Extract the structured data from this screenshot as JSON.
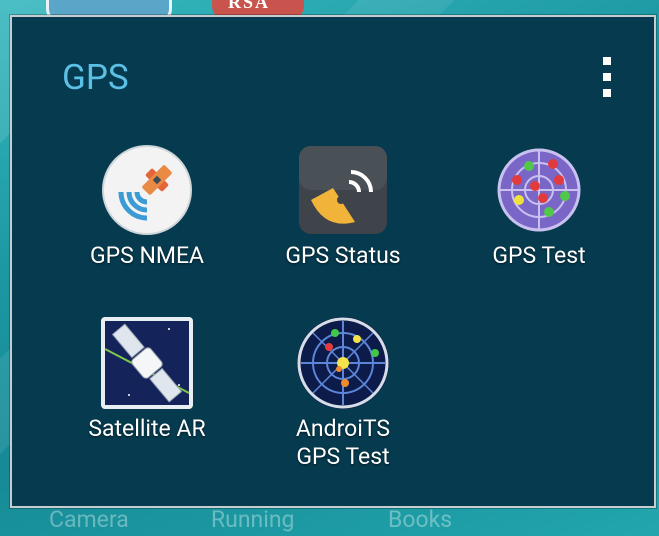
{
  "background": {
    "dock_labels": [
      "Camera",
      "Running",
      "Books"
    ],
    "top_icon_text": "RSA"
  },
  "folder": {
    "title": "GPS",
    "menu_icon": "overflow-menu-icon",
    "apps": [
      {
        "label": "GPS NMEA",
        "icon": "satellite-signal-icon"
      },
      {
        "label": "GPS Status",
        "icon": "satellite-dish-icon"
      },
      {
        "label": "GPS Test",
        "icon": "radar-dots-icon"
      },
      {
        "label": "Satellite AR",
        "icon": "satellite-orbit-icon"
      },
      {
        "label": "AndroiTS\nGPS Test",
        "icon": "radar-sky-icon"
      }
    ]
  },
  "colors": {
    "folder_bg": "#063b4f",
    "title": "#5cc0e6",
    "wallpaper": "#1f9fa8"
  }
}
